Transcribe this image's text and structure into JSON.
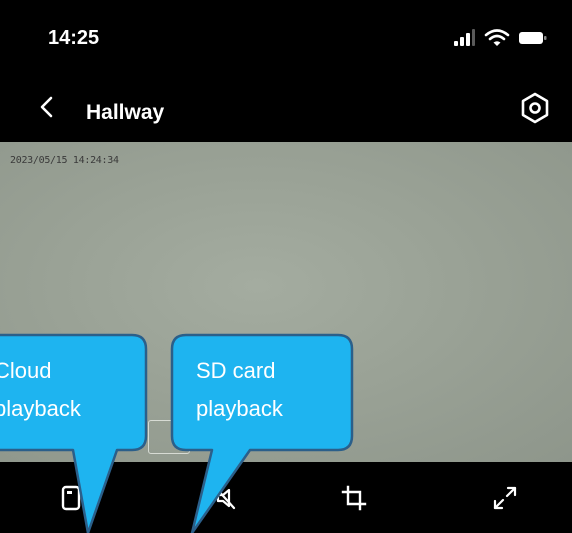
{
  "status_bar": {
    "time": "14:25",
    "icons": [
      "cellular-signal-icon",
      "wifi-icon",
      "battery-icon"
    ]
  },
  "nav": {
    "back_icon": "chevron-left-icon",
    "title": "Hallway",
    "settings_icon": "settings-icon"
  },
  "video": {
    "timestamp": "2023/05/15 14:24:34"
  },
  "controls": [
    {
      "name": "cloud-playback-icon"
    },
    {
      "name": "mute-icon"
    },
    {
      "name": "crop-icon"
    },
    {
      "name": "fullscreen-icon"
    }
  ],
  "callouts": {
    "cloud": {
      "line1": "Cloud",
      "line2": "playback"
    },
    "sd": {
      "line1": "SD card",
      "line2": "playback"
    }
  },
  "colors": {
    "callout_fill": "#1eb4f0",
    "callout_border": "#2b5f8a",
    "bar_background": "#000000",
    "feed_gray": "#9aa296"
  }
}
